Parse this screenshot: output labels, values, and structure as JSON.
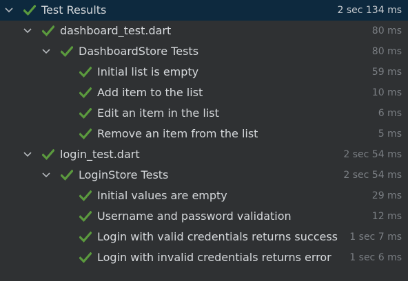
{
  "test_results": {
    "label": "Test Results",
    "time": "2 sec 134 ms",
    "files": [
      {
        "label": "dashboard_test.dart",
        "time": "80 ms",
        "group": {
          "label": "DashboardStore Tests",
          "time": "80 ms",
          "tests": [
            {
              "label": "Initial list is empty",
              "time": "59 ms"
            },
            {
              "label": "Add item to the list",
              "time": "10 ms"
            },
            {
              "label": "Edit an item in the list",
              "time": "6 ms"
            },
            {
              "label": "Remove an item from the list",
              "time": "5 ms"
            }
          ]
        }
      },
      {
        "label": "login_test.dart",
        "time": "2 sec 54 ms",
        "group": {
          "label": "LoginStore Tests",
          "time": "2 sec 54 ms",
          "tests": [
            {
              "label": "Initial values are empty",
              "time": "29 ms"
            },
            {
              "label": "Username and password validation",
              "time": "12 ms"
            },
            {
              "label": "Login with valid credentials returns success",
              "time": "1 sec 7 ms"
            },
            {
              "label": "Login with invalid credentials returns error",
              "time": "1 sec 6 ms"
            }
          ]
        }
      }
    ]
  },
  "icons": {
    "expand": "chevron-down-icon",
    "passed": "check-icon"
  },
  "colors": {
    "background": "#2f3133",
    "selected_row": "#0d293e",
    "passed": "#5b9a3e",
    "text": "#d6d9dc",
    "time": "#7b7f84"
  }
}
